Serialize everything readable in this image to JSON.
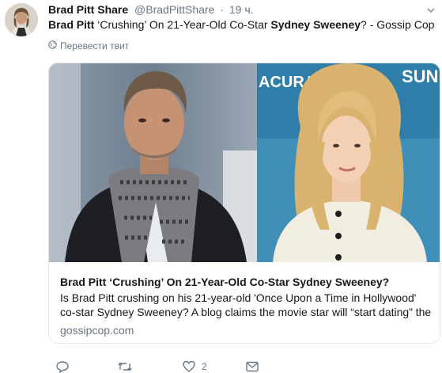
{
  "author": {
    "name": "Brad Pitt Share",
    "handle": "@BradPittShare",
    "separator": "·",
    "time": "19 ч."
  },
  "tweet": {
    "prefix_bold": "Brad Pitt",
    "middle": " ‘Crushing’ On 21-Year-Old Co-Star ",
    "name_bold": "Sydney Sweeney",
    "suffix": "? - Gossip Cop"
  },
  "translate_label": "Перевести твит",
  "card": {
    "banner_text_left": "ACURA",
    "banner_text_right": "SUND",
    "title": "Brad Pitt ‘Crushing’ On 21-Year-Old Co-Star Sydney Sweeney?",
    "description": "Is Brad Pitt crushing on his 21-year-old 'Once Upon a Time in Hollywood' co-star Sydney Sweeney? A blog claims the movie star will “start dating” the",
    "domain": "gossipcop.com"
  },
  "actions": {
    "reply_count": "",
    "retweet_count": "",
    "like_count": "2"
  },
  "colors": {
    "text": "#14171a",
    "secondary": "#657786",
    "border": "#e1e8ed"
  },
  "icons": [
    "reply-icon",
    "retweet-icon",
    "like-icon",
    "message-icon",
    "globe-icon",
    "caret-down-icon"
  ]
}
